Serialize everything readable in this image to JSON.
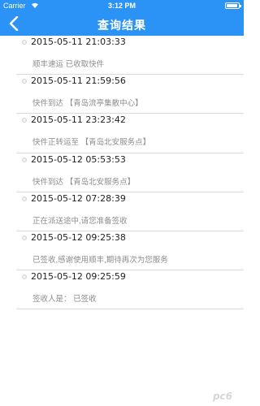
{
  "status_bar": {
    "carrier": "Carrier",
    "time": "3:12 PM",
    "wifi_icon": "wifi-icon",
    "battery_icon": "battery-icon"
  },
  "nav": {
    "back_icon": "chevron-left-icon",
    "title": "查询结果"
  },
  "records": [
    {
      "time": "2015-05-11 21:03:33",
      "desc": "顺丰速运 已收取快件"
    },
    {
      "time": "2015-05-11 21:59:56",
      "desc": "快件到达 【青岛流亭集散中心】"
    },
    {
      "time": "2015-05-11 23:23:42",
      "desc": "快件正转运至 【青岛北安服务点】"
    },
    {
      "time": "2015-05-12 05:53:53",
      "desc": "快件到达 【青岛北安服务点】"
    },
    {
      "time": "2015-05-12 07:28:39",
      "desc": "正在派送途中,请您准备签收"
    },
    {
      "time": "2015-05-12 09:25:38",
      "desc": "已签收,感谢使用顺丰,期待再次为您服务"
    },
    {
      "time": "2015-05-12 09:25:59",
      "desc": "签收人是：  已签收"
    }
  ],
  "watermark": "pc6"
}
